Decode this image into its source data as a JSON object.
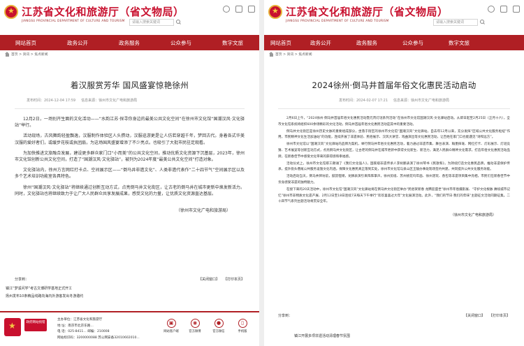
{
  "site": {
    "title": "江苏省文化和旅游厅（省文物局）",
    "subtitle": "JIANGSU PROVINCIAL DEPARTMENT OF CULTURE AND TOURISM",
    "search_placeholder": "请输入搜索关键词"
  },
  "nav": [
    "网站首页",
    "政务公开",
    "政务服务",
    "公众参与",
    "数字文旅"
  ],
  "breadcrumb": "首页 > 资讯 > 焦点新闻",
  "left_article": {
    "title": "着汉服赏芳华  国风盛宴惊艳徐州",
    "date": "发布时间：2024-12-04  17:59",
    "source": "信息来源：徐州市文化广电和旅游局",
    "paragraphs": [
      "12月2日，一场别开生面的文化活动——“水韵江苏·探寻你身边的最美公共文化空间”在徐州市文化馆“国潮汉风·文化驿站”举行。",
      "活动现场，古风舞韵轻盈飘逸，汉服制作体验区人头攒动，汉服巡游更是让人仿若穿越千年，梦回古代。身着各式华美汉服的爱好者们，或缓步花枝或执团扇，为这场国风盛宴增添了不少亮点。也吸引了大批市民驻足观看。",
      "为加快推进文旅融合发展，建设更多群众家门口“小而美”的公共文化空间，推动优质文化资源下沉基层，2023年，徐州市文化馆创新公共文化空间，打造了“国潮汉风·文化驿站”，被列为2024年度“最美公共文化空间”打造对象。",
      "文化驿站内，徐州方言网红打卡点、空间展示区——“倒马井非遗文化”、人类非遗代表作“二十四节气”空间展示区以及多个艺术培训功能室各具特色。",
      "徐州“国潮汉风·文化驿站”将继续通过创新互动方式，点亮倒马井文化街区，让古老的倒马井在城市更新中焕发新活力。同时，文化驿站也将继续致力于让广大人民群众共享发展成果，感受文化的力量，让优质文化资源直达基层。"
    ],
    "author": "（徐州市文化广电和旅游局）",
    "share_label": "分享到：",
    "share_actions": [
      "【关闭窗口】",
      "【打印本页】"
    ],
    "related": [
      "镇江“梦溪问学”考古文博研学基地正式开工",
      "扬州发布10条精品线路向海内外游客发出冬游邀约"
    ]
  },
  "right_article": {
    "title": "2024徐州·倒马井首届年俗文化惠民活动启动",
    "date": "发布时间：2024-02-07  17:21",
    "source": "信息来源：徐州市文化广电和旅游局",
    "paragraphs": [
      "2月6日上午，“2024徐州·倒马井首届年俗文化惠民活动暨元宵灯谜系列活动”在徐州市文化馆国潮汉风·文化驿站启动。从即日起至2月25日（正月十六），全市文化馆系统将组织600余场精彩的文化活动，倒马井首届年俗文化惠民活动是其中的重要活动。",
      "倒马井文化街区是徐州历史文脉的重要组成部分，坐落于街区的徐州市文化馆“国潮汉风”文化驿站，自去年12月以来，充分发挥“区域公共文化服务枢纽”作用，市民精神文化生活加油站”的功能，连续开展了非遗体验、民俗展示、汉风大讲堂、戏曲演出等文化惠民活动，让百姓在家门口也能遇见“诗和远方”。",
      "徐州市文化馆以“国潮汉风”文化驿站的品牌为契机，举行倒马井年俗文化惠民活动，着力通过非遗市集、舞台表演、翰墨挥毫、网红打卡、灯彩展示、灯谜竞猜、艺术展览等创新互动方式，点亮倒马井文化街区，让古老的倒马井在城市更新中获得文化新生、新活力，满足人民群众精神文化需求，打造年俗文化惠民活动品牌，在新春佳节中感受文化带来的获得感和幸福感。",
      "活动仪式上，徐州市文化馆职工朗诵了《我们文化强人》，国家级非遗传承人李树鹏表演了徐州琴书《民歌和》，为持续打造文化惠民品牌，推动非遗保护传承，提升街头巷尾公共服务设施文化内涵，保障文化惠民真正落到实处，徐州市文化馆与泉山区王陵办事处现场签约共建，共同提升公共文化服务效能。",
      "活动启动当天，倒马井牌坊前，鼓韵铿锵，龙狮表演引来阵阵掌声，徐州剪纸、苏州桃花坞年画、徐州泥玩、香包等非遗项目集中亮相，市民们在新春佳节中亲身感受非遗的独特魅力。",
      "在接下来的20天活动中，徐州市文化馆“国潮汉风”文化驿站将在倒马井文化街区举办“民俗贺新春 龙腾迎盛世”徐州市年俗摄影展、“守护文化根脉 赓续城市记忆”徐州市非物质文化遗产展、2月12日至18日连续7天每天下午举行“欢欢喜喜过大年”文化展演活动。此外，“我们的节日·我们的年味”主题征文活动同期征集。二十四节气系列主题活动将贯穿全年。"
    ],
    "author": "（徐州市文化广电和旅游局）",
    "share_label": "分享到：",
    "share_actions": [
      "【关闭窗口】",
      "【打印本页】"
    ],
    "related": [
      "镇江开展多项非遗活动清理春节氛围"
    ]
  },
  "footer": {
    "logo_text": "政府网站找错",
    "lines": [
      "主办单位：江苏省文化和旅游厅",
      "地    址：南京市北京东路...",
      "电    话：025-8411...   邮编：210008",
      "网站标识码：3200000088  苏公网安备32010602010..."
    ],
    "icons": [
      {
        "name": "app",
        "label": "网站客户端"
      },
      {
        "name": "weibo",
        "label": "官方微博"
      },
      {
        "name": "wechat",
        "label": "官方微信"
      },
      {
        "name": "phone",
        "label": "手机版"
      }
    ]
  }
}
